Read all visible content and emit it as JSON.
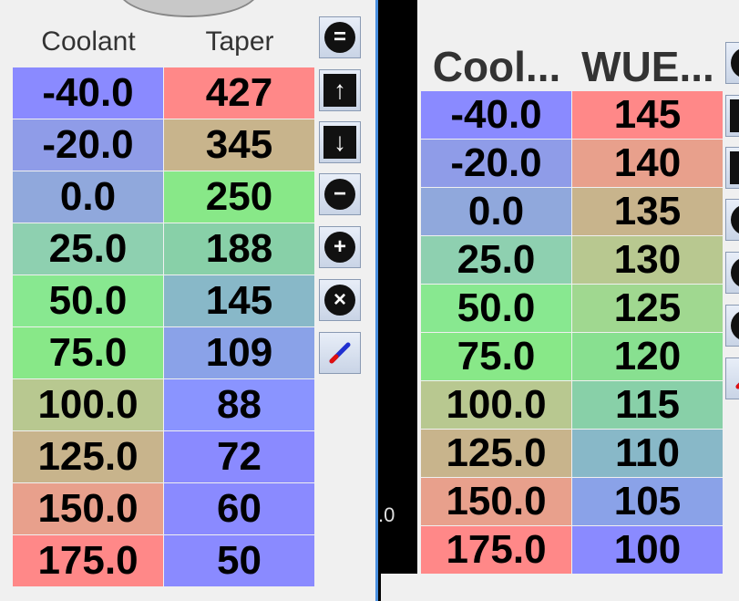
{
  "left_table": {
    "headers": [
      "Coolant",
      "Taper"
    ],
    "rows": [
      {
        "coolant": "-40.0",
        "taper": "427",
        "c_color": "#8a8aff",
        "t_color": "#ff8888"
      },
      {
        "coolant": "-20.0",
        "taper": "345",
        "c_color": "#8f9ce8",
        "t_color": "#c8b48c"
      },
      {
        "coolant": "0.0",
        "taper": "250",
        "c_color": "#90a8dc",
        "t_color": "#88e888"
      },
      {
        "coolant": "25.0",
        "taper": "188",
        "c_color": "#8ed0b0",
        "t_color": "#88d0a8"
      },
      {
        "coolant": "50.0",
        "taper": "145",
        "c_color": "#88e890",
        "t_color": "#88b8c8"
      },
      {
        "coolant": "75.0",
        "taper": "109",
        "c_color": "#88e888",
        "t_color": "#8aa2e8"
      },
      {
        "coolant": "100.0",
        "taper": "88",
        "c_color": "#b8c890",
        "t_color": "#8a94ff"
      },
      {
        "coolant": "125.0",
        "taper": "72",
        "c_color": "#c8b48c",
        "t_color": "#8a8aff"
      },
      {
        "coolant": "150.0",
        "taper": "60",
        "c_color": "#e8a08c",
        "t_color": "#8a8aff"
      },
      {
        "coolant": "175.0",
        "taper": "50",
        "c_color": "#ff8888",
        "t_color": "#8a8aff"
      }
    ]
  },
  "left_buttons": [
    {
      "name": "equals-icon",
      "glyph": "=",
      "shape": "circle"
    },
    {
      "name": "arrow-up-icon",
      "glyph": "↑",
      "shape": "square"
    },
    {
      "name": "arrow-down-icon",
      "glyph": "↓",
      "shape": "square"
    },
    {
      "name": "minus-icon",
      "glyph": "−",
      "shape": "circle"
    },
    {
      "name": "plus-icon",
      "glyph": "+",
      "shape": "circle"
    },
    {
      "name": "close-icon",
      "glyph": "×",
      "shape": "circle"
    },
    {
      "name": "pen-icon",
      "glyph": "",
      "shape": "pen"
    }
  ],
  "gap_text": ".0",
  "right_table": {
    "headers": [
      "Cool...",
      "WUE..."
    ],
    "rows": [
      {
        "coolant": "-40.0",
        "wue": "145",
        "c_color": "#8a8aff",
        "w_color": "#ff8888"
      },
      {
        "coolant": "-20.0",
        "wue": "140",
        "c_color": "#8f9ce8",
        "w_color": "#e8a08c"
      },
      {
        "coolant": "0.0",
        "wue": "135",
        "c_color": "#90a8dc",
        "w_color": "#c8b48c"
      },
      {
        "coolant": "25.0",
        "wue": "130",
        "c_color": "#8ed0b0",
        "w_color": "#b8c890"
      },
      {
        "coolant": "50.0",
        "wue": "125",
        "c_color": "#88e890",
        "w_color": "#a0d890"
      },
      {
        "coolant": "75.0",
        "wue": "120",
        "c_color": "#88e888",
        "w_color": "#88e090"
      },
      {
        "coolant": "100.0",
        "wue": "115",
        "c_color": "#b8c890",
        "w_color": "#88d0a8"
      },
      {
        "coolant": "125.0",
        "wue": "110",
        "c_color": "#c8b48c",
        "w_color": "#88b8c8"
      },
      {
        "coolant": "150.0",
        "wue": "105",
        "c_color": "#e8a08c",
        "w_color": "#8aa2e8"
      },
      {
        "coolant": "175.0",
        "wue": "100",
        "c_color": "#ff8888",
        "w_color": "#8a8aff"
      }
    ]
  }
}
